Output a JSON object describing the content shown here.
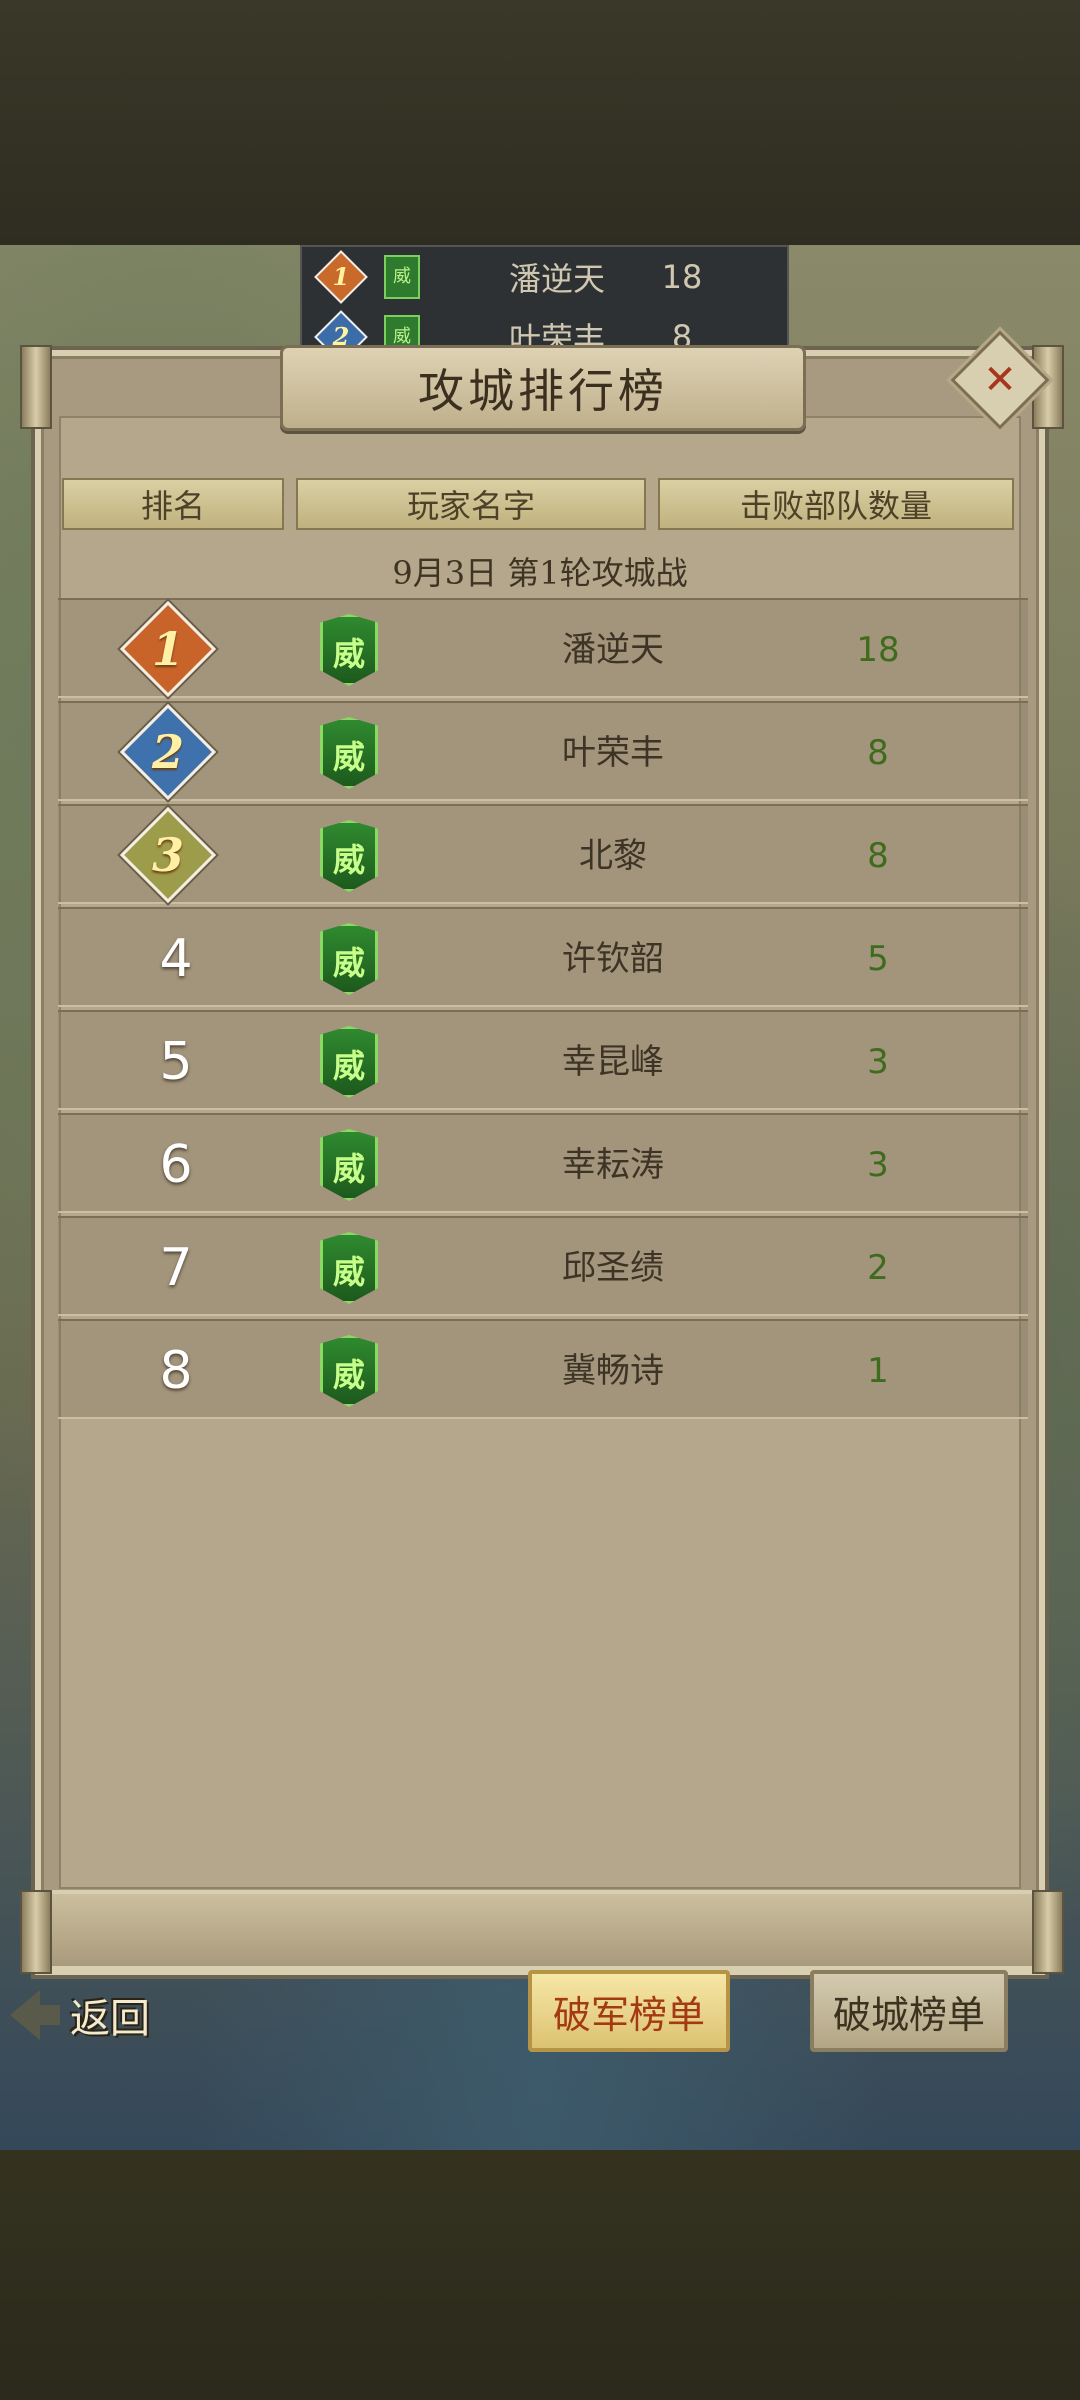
{
  "mini_list": [
    {
      "rank": "1",
      "badge": "威",
      "name": "潘逆天",
      "value": "18",
      "color": "#c96a2a"
    },
    {
      "rank": "2",
      "badge": "威",
      "name": "叶荣丰",
      "value": "8",
      "color": "#3d6da8"
    }
  ],
  "title": "攻城排行榜",
  "close_symbol": "✕",
  "headers": {
    "rank": "排名",
    "player": "玩家名字",
    "kills": "击败部队数量"
  },
  "round_label": "9月3日  第1轮攻城战",
  "rows": [
    {
      "rank": "1",
      "badge": "威",
      "name": "潘逆天",
      "value": "18",
      "medal_color": "#c8642a"
    },
    {
      "rank": "2",
      "badge": "威",
      "name": "叶荣丰",
      "value": "8",
      "medal_color": "#3f72ad"
    },
    {
      "rank": "3",
      "badge": "威",
      "name": "北黎",
      "value": "8",
      "medal_color": "#9d9c4a"
    },
    {
      "rank": "4",
      "badge": "威",
      "name": "许钦韶",
      "value": "5"
    },
    {
      "rank": "5",
      "badge": "威",
      "name": "幸昆峰",
      "value": "3"
    },
    {
      "rank": "6",
      "badge": "威",
      "name": "幸耘涛",
      "value": "3"
    },
    {
      "rank": "7",
      "badge": "威",
      "name": "邱圣绩",
      "value": "2"
    },
    {
      "rank": "8",
      "badge": "威",
      "name": "冀畅诗",
      "value": "1"
    }
  ],
  "footer": {
    "back_label": "返回",
    "tab_active": "破军榜单",
    "tab_inactive": "破城榜单"
  }
}
